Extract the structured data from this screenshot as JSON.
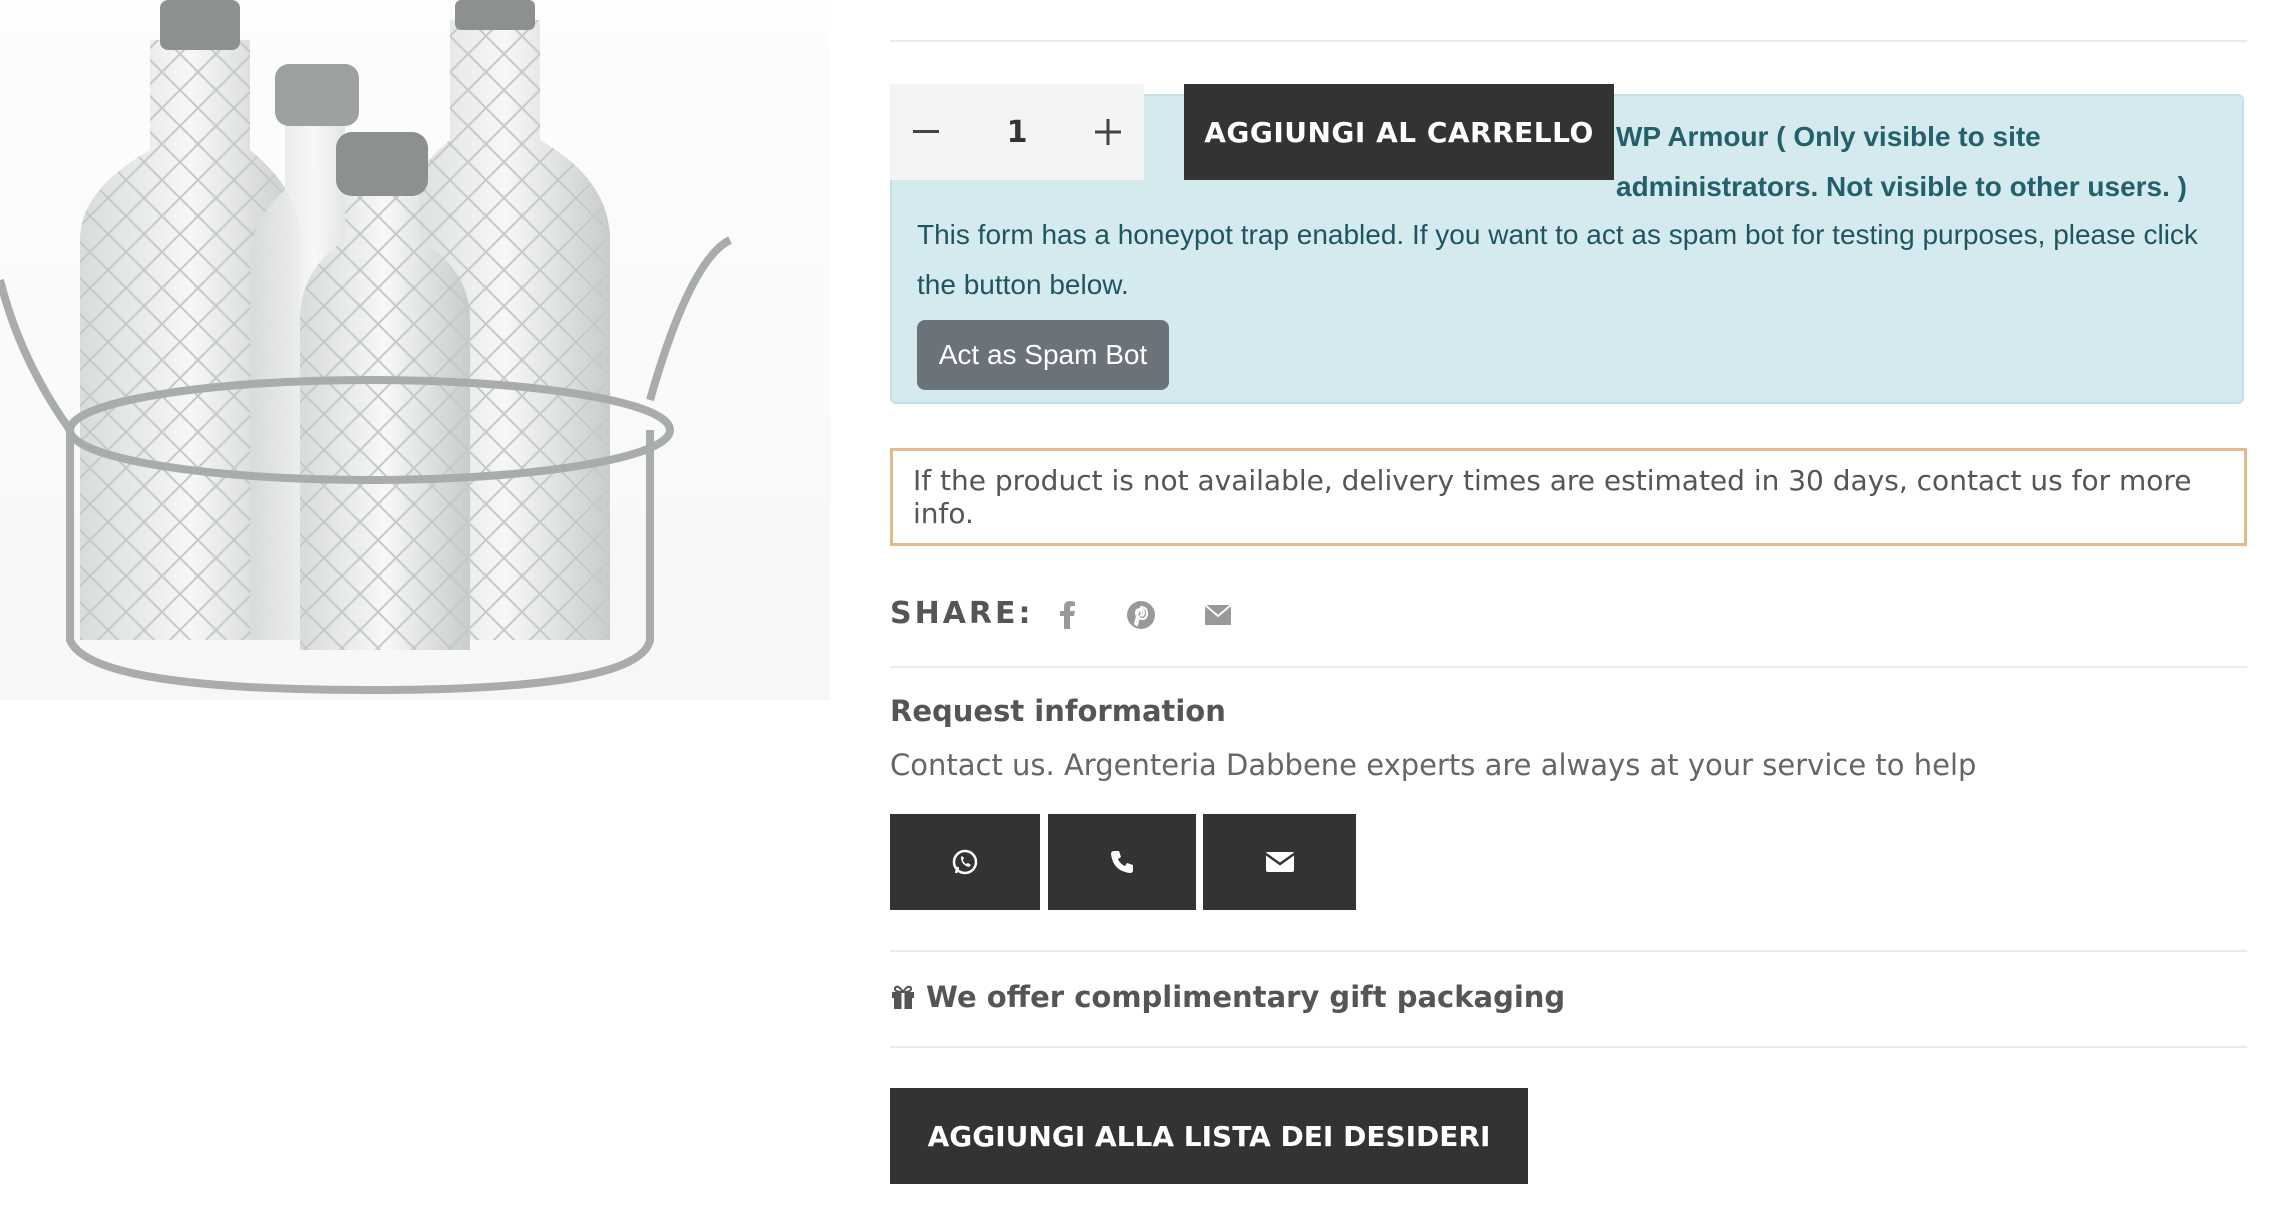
{
  "product": {
    "image_alt": "Glass cruet set with silver-plated holder"
  },
  "cart": {
    "quantity": "1",
    "minus_icon": "minus-icon",
    "plus_icon": "plus-icon",
    "add_label": "AGGIUNGI AL CARRELLO"
  },
  "armour": {
    "title": "WP Armour ( Only visible to site administrators. Not visible to other users. )",
    "text": "This form has a honeypot trap enabled. If you want to act as spam bot for testing purposes, please click the button below.",
    "button": "Act as Spam Bot"
  },
  "delivery_notice": "If the product is not available, delivery times are estimated in 30 days, contact us for more info.",
  "share": {
    "label": "SHARE:",
    "icons": [
      "facebook-icon",
      "pinterest-icon",
      "email-icon"
    ]
  },
  "request": {
    "title": "Request information",
    "text": "Contact us. Argenteria Dabbene experts are always at your service to help",
    "buttons": [
      "whatsapp-icon",
      "phone-icon",
      "envelope-icon"
    ]
  },
  "gift": {
    "icon": "gift-icon",
    "text": "We offer complimentary gift packaging"
  },
  "wishlist_label": "AGGIUNGI ALLA LISTA DEI DESIDERI",
  "colors": {
    "dark_button": "#333333",
    "notice_bg": "#d5eaef",
    "notice_text": "#24606b",
    "delivery_border": "#e1bc8a"
  }
}
